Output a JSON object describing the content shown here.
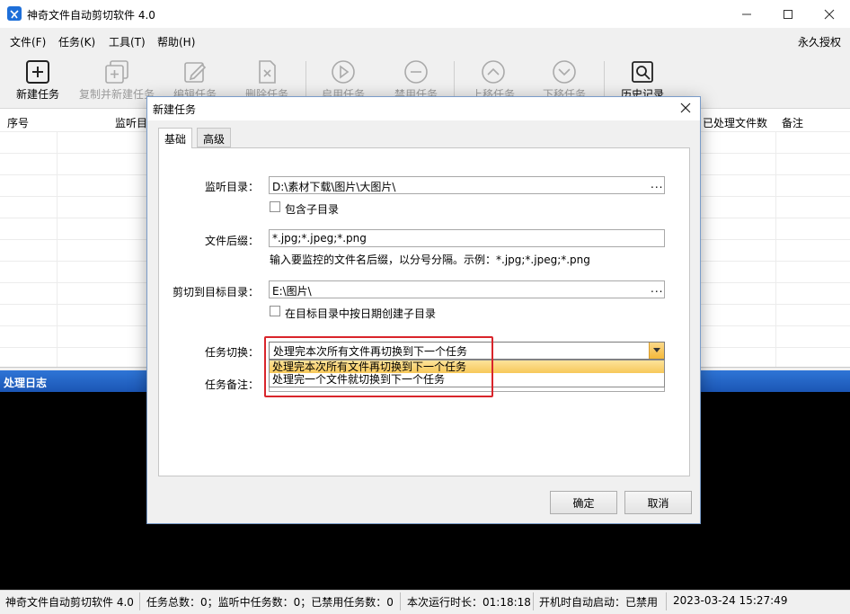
{
  "window": {
    "title": "神奇文件自动剪切软件 4.0",
    "minimize_icon": "minimize-icon",
    "maximize_icon": "maximize-icon",
    "close_icon": "close-icon"
  },
  "menu": {
    "items": [
      "文件(F)",
      "任务(K)",
      "工具(T)",
      "帮助(H)"
    ],
    "license": "永久授权"
  },
  "toolbar": {
    "buttons": [
      {
        "label": "新建任务",
        "icon": "plus-square-icon",
        "enabled": true
      },
      {
        "label": "复制并新建任务",
        "icon": "copy-plus-icon",
        "enabled": false
      },
      {
        "label": "编辑任务",
        "icon": "edit-icon",
        "enabled": false
      },
      {
        "label": "删除任务",
        "icon": "delete-icon",
        "enabled": false
      },
      {
        "label": "启用任务",
        "icon": "play-icon",
        "enabled": false
      },
      {
        "label": "禁用任务",
        "icon": "minus-circle-icon",
        "enabled": false
      },
      {
        "label": "上移任务",
        "icon": "chevron-up-icon",
        "enabled": false
      },
      {
        "label": "下移任务",
        "icon": "chevron-down-icon",
        "enabled": false
      },
      {
        "label": "历史记录",
        "icon": "search-history-icon",
        "enabled": true
      }
    ]
  },
  "table": {
    "columns": [
      "序号",
      "监听目录",
      "已处理文件数",
      "备注"
    ]
  },
  "log": {
    "title": "处理日志"
  },
  "statusbar": {
    "app": "神奇文件自动剪切软件 4.0",
    "tasks": "任务总数：0；监听中任务数：0；已禁用任务数：0",
    "runtime": "本次运行时长：01:18:18",
    "autostart": "开机时自动启动：已禁用",
    "datetime": "2023-03-24 15:27:49"
  },
  "dialog": {
    "title": "新建任务",
    "tabs": [
      "基础",
      "高级"
    ],
    "active_tab": "基础",
    "watch_dir": {
      "label": "监听目录：",
      "value": "D:\\素材下载\\图片\\大图片\\",
      "browse": "..."
    },
    "include_subdirs": {
      "label": "包含子目录",
      "checked": false
    },
    "suffix": {
      "label": "文件后缀：",
      "value": "*.jpg;*.jpeg;*.png",
      "hint": "输入要监控的文件名后缀，以分号分隔。示例：*.jpg;*.jpeg;*.png"
    },
    "target_dir": {
      "label": "剪切到目标目录：",
      "value": "E:\\图片\\",
      "browse": "..."
    },
    "date_subdir": {
      "label": "在目标目录中按日期创建子目录",
      "checked": false
    },
    "switch": {
      "label": "任务切换：",
      "selected": "处理完本次所有文件再切换到下一个任务",
      "options": [
        "处理完本次所有文件再切换到下一个任务",
        "处理完一个文件就切换到下一个任务"
      ]
    },
    "remark": {
      "label": "任务备注："
    },
    "ok": "确定",
    "cancel": "取消"
  },
  "colors": {
    "log_header": "#1f5fbf",
    "highlight_border": "#d9252b",
    "dropdown_selected": "#f7c85a"
  }
}
